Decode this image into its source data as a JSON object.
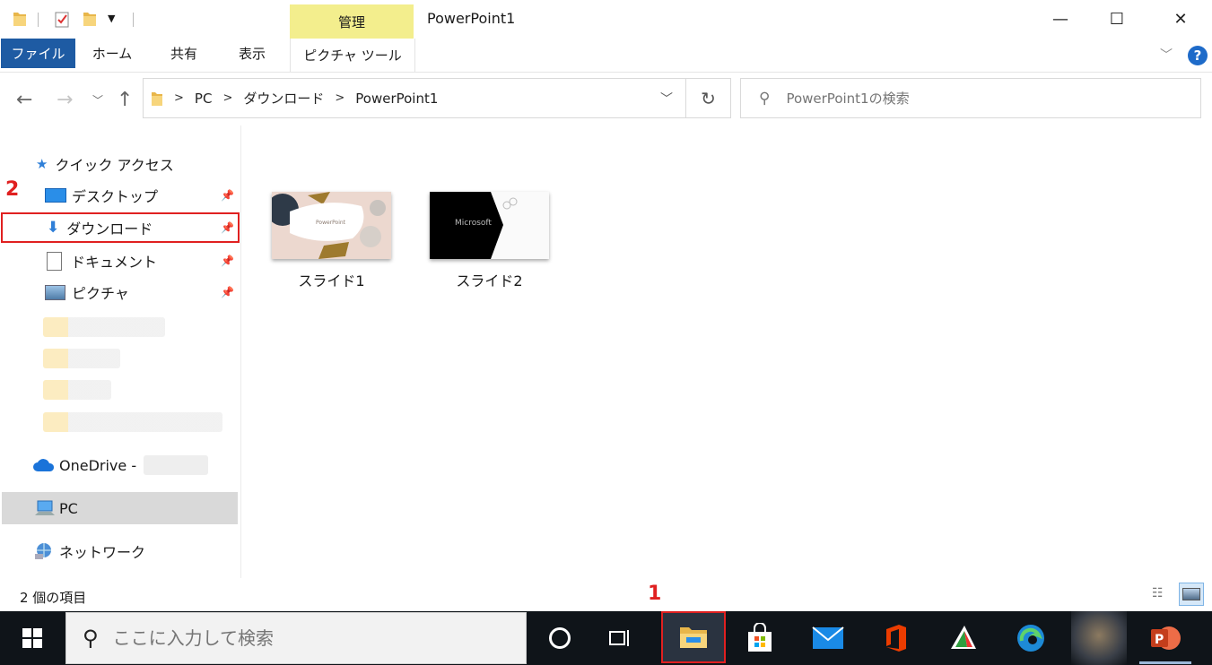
{
  "window": {
    "title": "PowerPoint1",
    "manage_tab": "管理",
    "minimize": "—",
    "maximize": "☐",
    "close": "✕"
  },
  "ribbon": {
    "tabs": [
      {
        "label": "ファイル"
      },
      {
        "label": "ホーム"
      },
      {
        "label": "共有"
      },
      {
        "label": "表示"
      },
      {
        "label": "ピクチャ ツール"
      }
    ],
    "help": "?"
  },
  "address": {
    "crumbs": [
      "PC",
      "ダウンロード",
      "PowerPoint1"
    ],
    "search_placeholder": "PowerPoint1の検索"
  },
  "sidebar": {
    "quick_access": "クイック アクセス",
    "items": [
      {
        "label": "デスクトップ"
      },
      {
        "label": "ダウンロード"
      },
      {
        "label": "ドキュメント"
      },
      {
        "label": "ピクチャ"
      }
    ],
    "onedrive": "OneDrive -",
    "pc": "PC",
    "network": "ネットワーク"
  },
  "files": [
    {
      "name": "スライド1",
      "thumb_text": "PowerPoint"
    },
    {
      "name": "スライド2",
      "thumb_text": "Microsoft"
    }
  ],
  "status": {
    "count": "2 個の項目"
  },
  "taskbar": {
    "search_placeholder": "ここに入力して検索"
  },
  "annotations": {
    "step1": "1",
    "step2": "2"
  },
  "colors": {
    "file_tab": "#1e5ba3",
    "manage_tab": "#f3ee8d",
    "highlight_box": "#e02020",
    "taskbar": "#0f1419"
  }
}
